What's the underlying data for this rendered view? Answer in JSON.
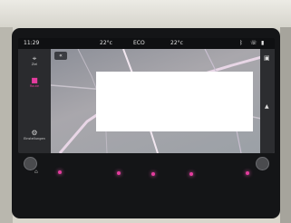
{
  "status": {
    "time": "11:29",
    "temp_left": "22°c",
    "temp_center": "22°c",
    "mode": "ECO"
  },
  "sidebar": {
    "items": [
      {
        "label": "Ziel",
        "icon": "destination-icon"
      },
      {
        "label": "Route",
        "icon": "route-icon"
      },
      {
        "label": "Einstellungen",
        "icon": "settings-icon"
      }
    ]
  },
  "colors": {
    "accent": "#e43c9e",
    "screen_bg": "#1b1c1f",
    "map_bg": "#9da0a7"
  }
}
